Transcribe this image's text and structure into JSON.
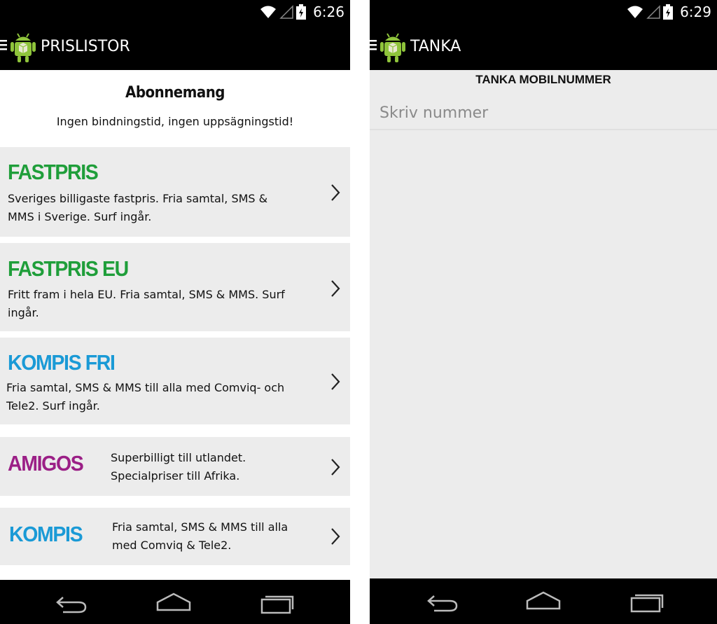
{
  "left": {
    "status": {
      "time": "6:26"
    },
    "actionbar": {
      "title": "PRISLISTOR"
    },
    "header": {
      "title": "Abonnemang",
      "subtitle": "Ingen bindningstid, ingen uppsägningstid!"
    },
    "plans": [
      {
        "name": "FASTPRIS",
        "desc_lines": [
          "Sveriges billigaste fastpris. Fria samtal, SMS &",
          "MMS i Sverige. Surf ingår."
        ],
        "color": "#1f9e3a"
      },
      {
        "name": "FASTPRIS EU",
        "desc_lines": [
          "Fritt fram i hela EU. Fria samtal, SMS & MMS. Surf",
          "ingår."
        ],
        "color": "#1f9e3a"
      },
      {
        "name": "KOMPIS FRI",
        "desc_lines": [
          "Fria samtal, SMS & MMS till alla med Comviq- och",
          "Tele2. Surf ingår."
        ],
        "color": "#1a9ad6"
      },
      {
        "name": "AMIGOS",
        "desc_lines": [
          "Superbilligt till utlandet.",
          "Specialpriser till Afrika."
        ],
        "color": "#9b1f86"
      },
      {
        "name": "KOMPIS",
        "desc_lines": [
          "Fria samtal, SMS & MMS till alla",
          "med Comviq & Tele2."
        ],
        "color": "#1a9ad6"
      }
    ]
  },
  "right": {
    "status": {
      "time": "6:29"
    },
    "actionbar": {
      "title": "TANKA"
    },
    "section_title": "TANKA MOBILNUMMER",
    "phone_input": {
      "placeholder": "Skriv nummer",
      "value": ""
    }
  },
  "icons": {
    "status": [
      "wifi-icon",
      "signal-icon",
      "battery-icon"
    ],
    "navbar": [
      "back-icon",
      "home-icon",
      "recents-icon"
    ],
    "app": "android-app-icon",
    "chevron": "chevron-right-icon"
  }
}
